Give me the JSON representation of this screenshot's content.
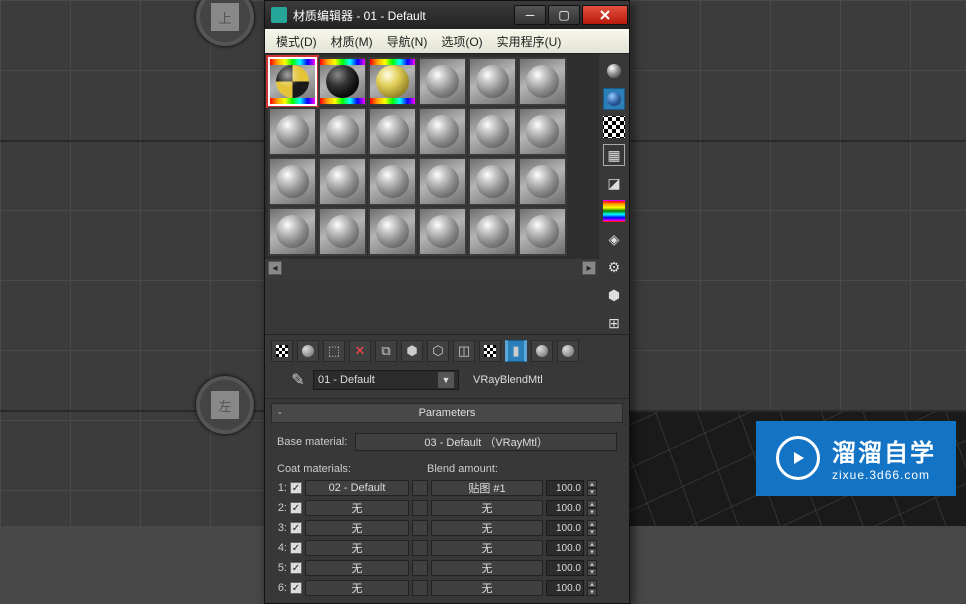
{
  "window": {
    "title": "材质编辑器 - 01 - Default",
    "menu": [
      "模式(D)",
      "材质(M)",
      "导航(N)",
      "选项(O)",
      "实用程序(U)"
    ]
  },
  "side_tools": [
    "sample-type",
    "backlight",
    "background",
    "sample-uv",
    "video-color",
    "options",
    "gradient",
    "make-preview",
    "material-map",
    "select-by-material"
  ],
  "toolbar": [
    "get-material",
    "put-to-scene",
    "assign-to-sel",
    "reset-map",
    "delete",
    "make-copy",
    "make-unique",
    "put-to-library",
    "material-id",
    "show-in-viewport",
    "show-end-result",
    "go-to-parent",
    "go-forward"
  ],
  "material": {
    "name": "01 - Default",
    "type": "VRayBlendMtl"
  },
  "rollout": {
    "title": "Parameters",
    "base_label": "Base material:",
    "base_value": "03 - Default （VRayMtl）",
    "coat_label": "Coat materials:",
    "blend_label": "Blend amount:",
    "rows": [
      {
        "i": "1:",
        "mat": "02 - Default",
        "map": "贴图 #1",
        "val": "100.0"
      },
      {
        "i": "2:",
        "mat": "无",
        "map": "无",
        "val": "100.0"
      },
      {
        "i": "3:",
        "mat": "无",
        "map": "无",
        "val": "100.0"
      },
      {
        "i": "4:",
        "mat": "无",
        "map": "无",
        "val": "100.0"
      },
      {
        "i": "5:",
        "mat": "无",
        "map": "无",
        "val": "100.0"
      },
      {
        "i": "6:",
        "mat": "无",
        "map": "无",
        "val": "100.0"
      }
    ]
  },
  "viewcube": {
    "top": "上",
    "left": "左"
  },
  "brand": {
    "t1": "溜溜自学",
    "t2": "zixue.3d66.com"
  }
}
